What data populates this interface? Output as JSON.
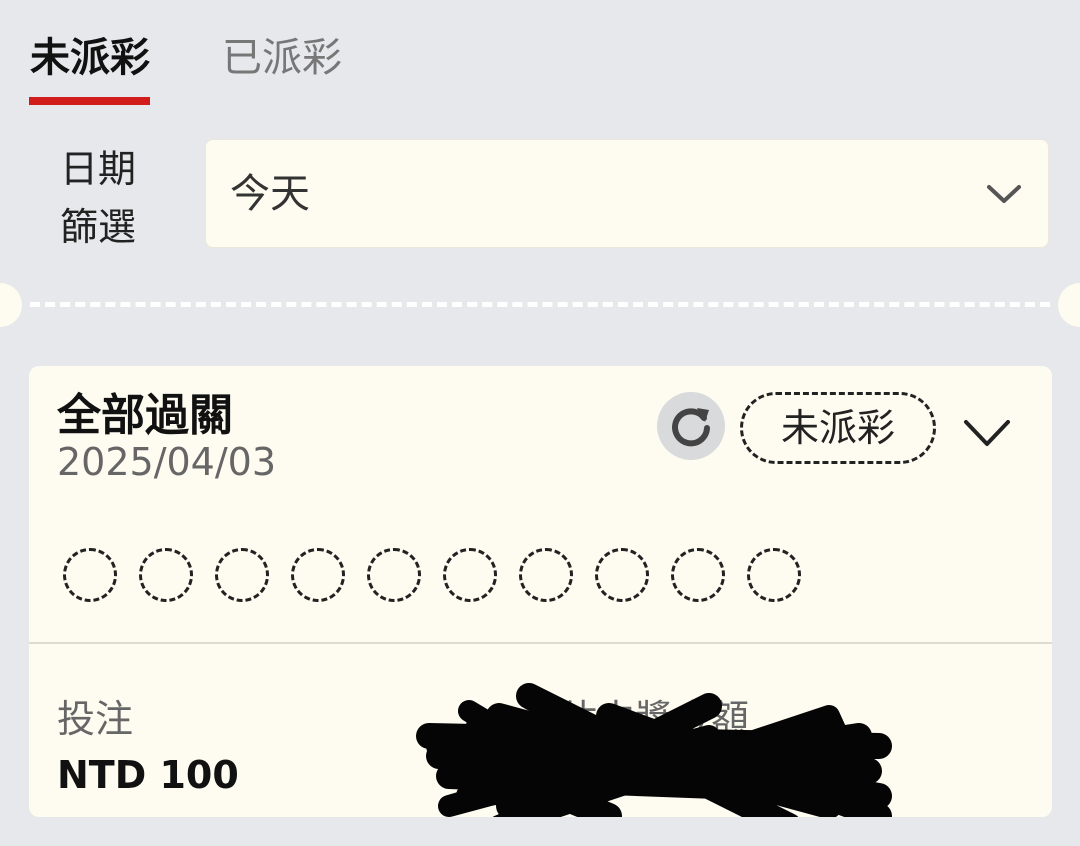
{
  "tabs": [
    {
      "label": "未派彩",
      "active": true
    },
    {
      "label": "已派彩",
      "active": false
    }
  ],
  "date_filter": {
    "label_line1": "日期",
    "label_line2": "篩選",
    "selected": "今天"
  },
  "bet_card": {
    "title": "全部過關",
    "date": "2025/04/03",
    "status": "未派彩",
    "selection_slots": 10,
    "stake_label": "投注",
    "stake_value": "NTD 100",
    "payout_label": "預估中獎金額"
  },
  "colors": {
    "accent": "#d21c1c",
    "card_bg": "#fefcf1",
    "page_bg": "#e6e8eb"
  }
}
